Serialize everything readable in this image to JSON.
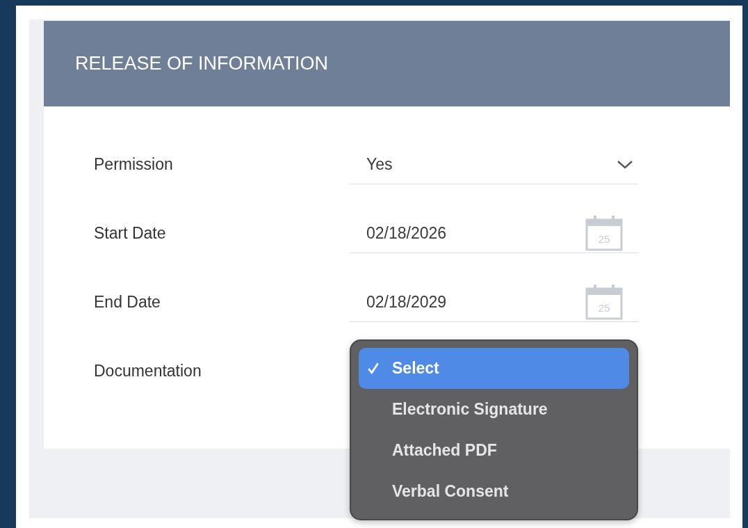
{
  "section": {
    "title": "RELEASE OF INFORMATION"
  },
  "fields": [
    {
      "label": "Permission",
      "kind": "select",
      "value": "Yes"
    },
    {
      "label": "Start Date",
      "kind": "date",
      "value": "02/18/2026",
      "calendar_day": "25"
    },
    {
      "label": "End Date",
      "kind": "date",
      "value": "02/18/2029",
      "calendar_day": "25"
    },
    {
      "label": "Documentation",
      "kind": "select",
      "expanded": true,
      "options": [
        {
          "label": "Select",
          "selected": true
        },
        {
          "label": "Electronic Signature",
          "selected": false
        },
        {
          "label": "Attached PDF",
          "selected": false
        },
        {
          "label": "Verbal Consent",
          "selected": false
        }
      ]
    }
  ]
}
